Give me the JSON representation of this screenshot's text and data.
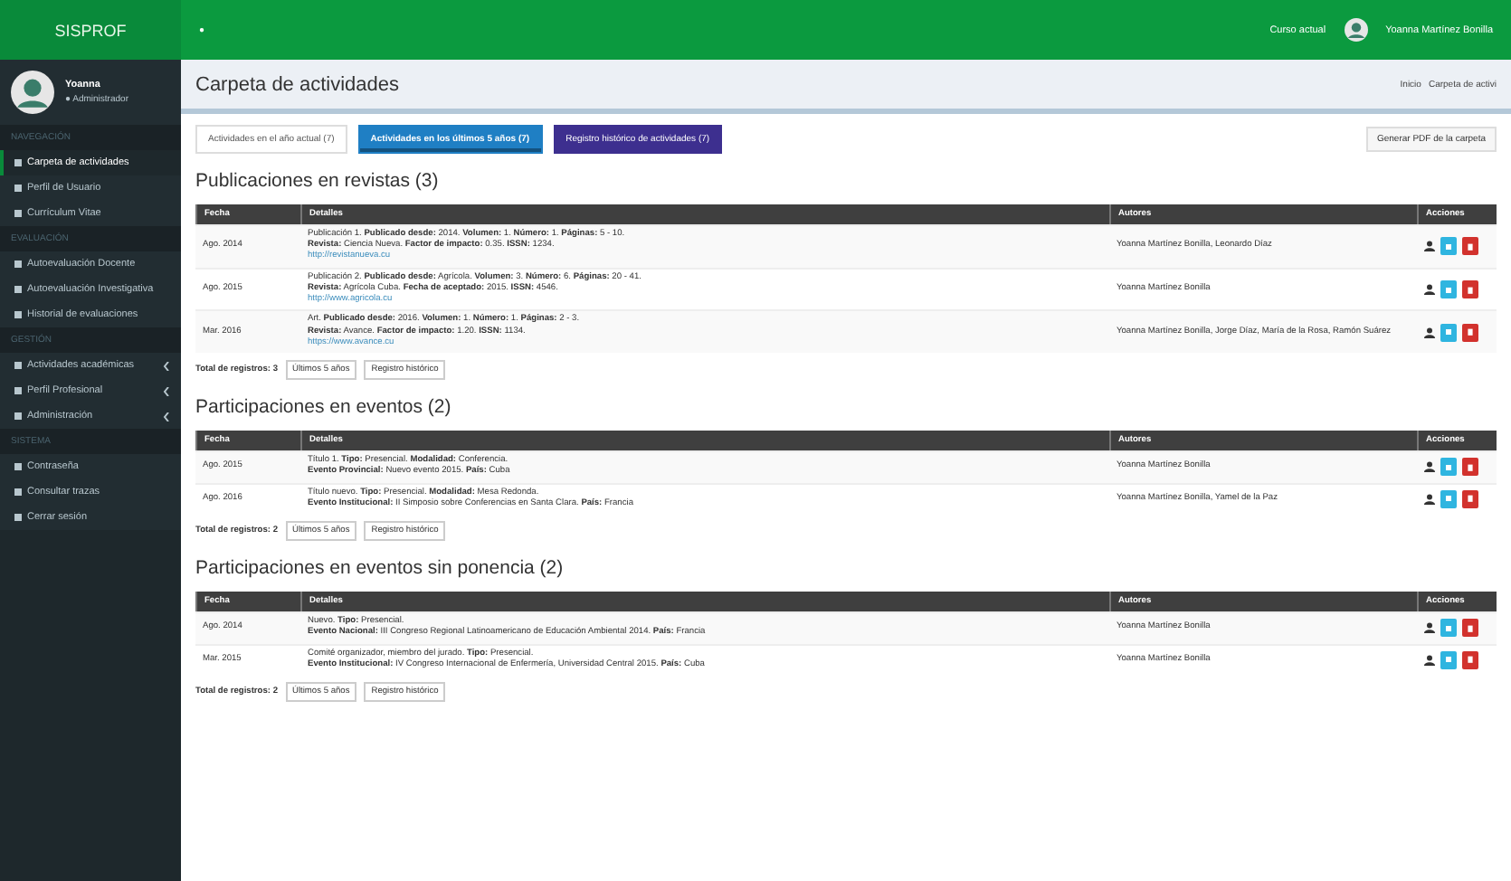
{
  "brand": "SISPROF",
  "topbar": {
    "menu_toggle": "●",
    "course": "Curso actual",
    "user": "Yoanna Martínez Bonilla"
  },
  "sidebar": {
    "user": {
      "name": "Yoanna",
      "role": "● Administrador"
    },
    "sections": [
      {
        "header": "NAVEGACIÓN",
        "items": [
          {
            "label": "Carpeta de actividades",
            "selected": true,
            "has_children": false
          },
          {
            "label": "Perfil de Usuario",
            "selected": false,
            "has_children": false
          },
          {
            "label": "Currículum Vitae",
            "selected": false,
            "has_children": false
          }
        ]
      },
      {
        "header": "EVALUACIÓN",
        "items": [
          {
            "label": "Autoevaluación Docente",
            "selected": false,
            "has_children": false
          },
          {
            "label": "Autoevaluación Investigativa",
            "selected": false,
            "has_children": false
          },
          {
            "label": "Historial de evaluaciones",
            "selected": false,
            "has_children": false
          }
        ]
      },
      {
        "header": "GESTIÓN",
        "items": [
          {
            "label": "Actividades académicas",
            "selected": false,
            "has_children": true
          },
          {
            "label": "Perfil Profesional",
            "selected": false,
            "has_children": true
          },
          {
            "label": "Administración",
            "selected": false,
            "has_children": true
          }
        ]
      },
      {
        "header": "SISTEMA",
        "items": [
          {
            "label": "Contraseña",
            "selected": false,
            "has_children": false
          },
          {
            "label": "Consultar trazas",
            "selected": false,
            "has_children": false
          },
          {
            "label": "Cerrar sesión",
            "selected": false,
            "has_children": false
          }
        ]
      }
    ]
  },
  "page": {
    "title": "Carpeta de actividades",
    "breadcrumb": [
      "Inicio",
      "Carpeta de activi"
    ]
  },
  "tabs": [
    {
      "label": "Actividades en el año actual (7)",
      "selected": false,
      "color": "#ffffff"
    },
    {
      "label": "Actividades en los últimos 5 años (7)",
      "selected": true,
      "color": "#1f7fc4"
    },
    {
      "label": "Registro histórico de actividades (7)",
      "selected": false,
      "color": "#3d2f8f"
    }
  ],
  "pdf_button": "Generar PDF de la carpeta",
  "sections": [
    {
      "title": "Publicaciones en revistas (3)",
      "columns": [
        "Fecha",
        "Detalles",
        "Autores",
        "Acciones"
      ],
      "pager_buttons": [
        "Últimos 5 años",
        "Registro histórico"
      ],
      "rows": [
        {
          "date": "Ago. 2014",
          "lines": [
            "Publicación 1. **Publicado desde:** 2014. **Volumen:** 1. **Número:** 1. **Páginas:** 5 - 10.",
            "**Revista:** Ciencia Nueva. **Factor de impacto:** 0.35. **ISSN:** 1234.",
            "http://revistanueva.cu"
          ],
          "authors": "Yoanna Martínez Bonilla, Leonardo Díaz"
        },
        {
          "date": "Ago. 2015",
          "lines": [
            "Publicación 2. **Publicado desde:** Agrícola. **Volumen:** 3. **Número:** 6. **Páginas:** 20 - 41.",
            "**Revista:** Agrícola Cuba. **Fecha de aceptado:** 2015. **ISSN:** 4546.",
            "http://www.agricola.cu"
          ],
          "authors": "Yoanna Martínez Bonilla"
        },
        {
          "date": "Mar. 2016",
          "lines": [
            "Art. **Publicado desde:** 2016. **Volumen:** 1. **Número:** 1. **Páginas:** 2 - 3.",
            "**Revista:** Avance. **Factor de impacto:** 1.20. **ISSN:** 1134.",
            "https://www.avance.cu"
          ],
          "authors": "Yoanna Martínez Bonilla, Jorge Díaz, María de la Rosa, Ramón Suárez"
        }
      ],
      "total": "Total de registros: 3"
    },
    {
      "title": "Participaciones en eventos (2)",
      "columns": [
        "Fecha",
        "Detalles",
        "Autores",
        "Acciones"
      ],
      "pager_buttons": [
        "Últimos 5 años",
        "Registro histórico"
      ],
      "rows": [
        {
          "date": "Ago. 2015",
          "lines": [
            "Título 1. **Tipo:** Presencial. **Modalidad:** Conferencia.",
            "**Evento Provincial:** Nuevo evento 2015. **País:** Cuba"
          ],
          "authors": "Yoanna Martínez Bonilla"
        },
        {
          "date": "Ago. 2016",
          "lines": [
            "Título nuevo. **Tipo:** Presencial. **Modalidad:** Mesa Redonda.",
            "**Evento Institucional:** II Simposio sobre Conferencias en Santa Clara. **País:** Francia"
          ],
          "authors": "Yoanna Martínez Bonilla, Yamel de la Paz"
        }
      ],
      "total": "Total de registros: 2"
    },
    {
      "title": "Participaciones en eventos sin ponencia (2)",
      "columns": [
        "Fecha",
        "Detalles",
        "Autores",
        "Acciones"
      ],
      "pager_buttons": [
        "Últimos 5 años",
        "Registro histórico"
      ],
      "rows": [
        {
          "date": "Ago. 2014",
          "lines": [
            "Nuevo. **Tipo:** Presencial.",
            "**Evento Nacional:** III Congreso Regional Latinoamericano de Educación Ambiental 2014. **País:** Francia"
          ],
          "authors": "Yoanna Martínez Bonilla"
        },
        {
          "date": "Mar. 2015",
          "lines": [
            "Comité organizador, miembro del jurado. **Tipo:** Presencial.",
            "**Evento Institucional:** IV Congreso Internacional de Enfermería, Universidad Central 2015. **País:** Cuba"
          ],
          "authors": "Yoanna Martínez Bonilla"
        }
      ],
      "total": "Total de registros: 2"
    }
  ]
}
